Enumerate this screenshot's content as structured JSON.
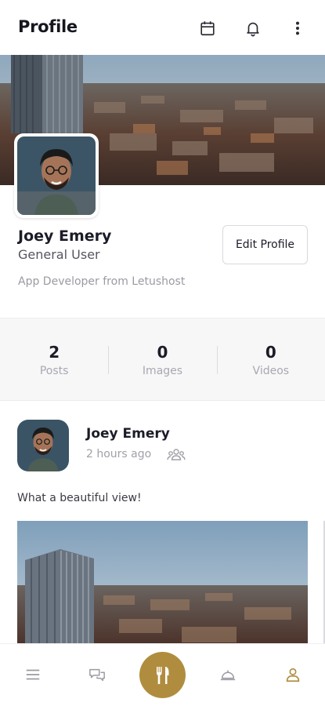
{
  "header": {
    "title": "Profile",
    "icons": [
      "calendar-icon",
      "bell-icon",
      "more-vertical-icon"
    ]
  },
  "profile": {
    "name": "Joey Emery",
    "role": "General User",
    "bio": "App Developer from Letushost",
    "edit_label": "Edit Profile"
  },
  "stats": [
    {
      "value": "2",
      "label": "Posts"
    },
    {
      "value": "0",
      "label": "Images"
    },
    {
      "value": "0",
      "label": "Videos"
    }
  ],
  "post": {
    "author": "Joey Emery",
    "time": "2 hours ago",
    "privacy_icon": "friends-icon",
    "text": "What a beautiful view!"
  },
  "bottom_nav": {
    "items": [
      "menu-icon",
      "chat-icon",
      "restaurant-icon",
      "service-bell-icon",
      "user-icon"
    ],
    "active": "user-icon"
  },
  "colors": {
    "accent": "#b08d3e",
    "text": "#1c1c28",
    "muted": "#a0a0a8",
    "nav_inactive": "#9a9aa3"
  }
}
